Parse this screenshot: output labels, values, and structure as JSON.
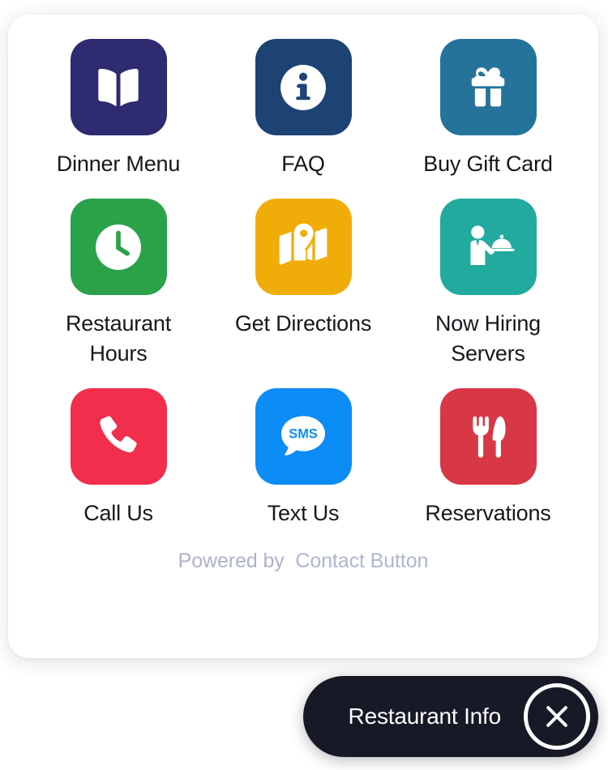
{
  "widget": {
    "card": {
      "items": [
        {
          "label": "Dinner Menu",
          "icon": "book-open-icon",
          "color": "#2E2B71"
        },
        {
          "label": "FAQ",
          "icon": "info-circle-icon",
          "color": "#1D4375"
        },
        {
          "label": "Buy Gift Card",
          "icon": "gift-icon",
          "color": "#25739A"
        },
        {
          "label": "Restaurant Hours",
          "icon": "clock-icon",
          "color": "#2BA24A"
        },
        {
          "label": "Get Directions",
          "icon": "map-pin-icon",
          "color": "#F0AD09"
        },
        {
          "label": "Now Hiring Servers",
          "icon": "waiter-tray-icon",
          "color": "#22AA9E"
        },
        {
          "label": "Call Us",
          "icon": "phone-icon",
          "color": "#F12E4B"
        },
        {
          "label": "Text Us",
          "icon": "sms-bubble-icon",
          "color": "#0C8CF5"
        },
        {
          "label": "Reservations",
          "icon": "fork-knife-icon",
          "color": "#D83745"
        }
      ],
      "footer": {
        "powered_by": "Powered by",
        "brand": "Contact Button"
      }
    },
    "launcher": {
      "label": "Restaurant Info",
      "close_icon": "close-x-icon",
      "background": "#171A26"
    }
  }
}
